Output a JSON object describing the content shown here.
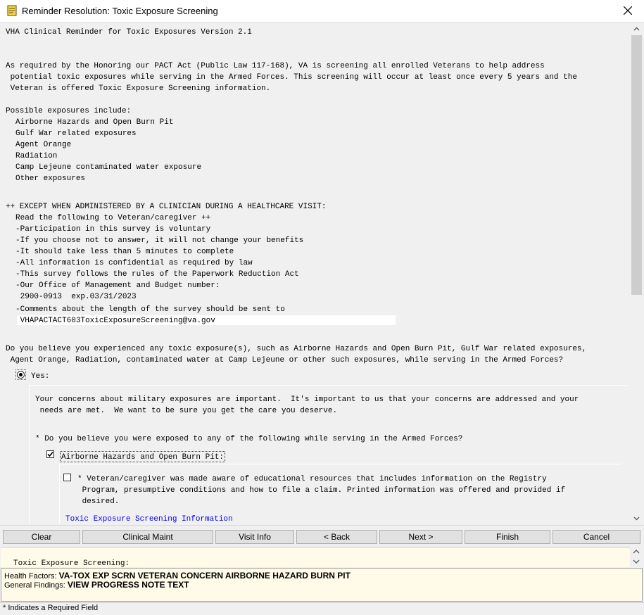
{
  "window": {
    "title": "Reminder Resolution: Toxic Exposure Screening",
    "icon": "reminder-app-icon"
  },
  "content": {
    "header": "VHA Clinical Reminder for Toxic Exposures Version 2.1",
    "intro_lines": [
      "As required by the Honoring our PACT Act (Public Law 117-168), VA is screening all enrolled Veterans to help address",
      " potential toxic exposures while serving in the Armed Forces. This screening will occur at least once every 5 years and the",
      " Veteran is offered Toxic Exposure Screening information."
    ],
    "exposures_heading": "Possible exposures include:",
    "exposures": [
      "Airborne Hazards and Open Burn Pit",
      "Gulf War related exposures",
      "Agent Orange",
      "Radiation",
      "Camp Lejeune contaminated water exposure",
      "Other exposures"
    ],
    "except_heading": "++ EXCEPT WHEN ADMINISTERED BY A CLINICIAN DURING A HEALTHCARE VISIT:",
    "except_lines": [
      "Read the following to Veteran/caregiver ++",
      "-Participation in this survey is voluntary",
      "-If you choose not to answer, it will not change your benefits",
      "-It should take less than 5 minutes to complete",
      "-All information is confidential as required by law",
      "-This survey follows the rules of the Paperwork Reduction Act",
      "-Our Office of Management and Budget number:",
      " 2900-0913  exp.03/31/2023",
      "-Comments about the length of the survey should be sent to",
      " VHAPACTACT603ToxicExposureScreening@va.gov"
    ],
    "question_lines": [
      "Do you believe you experienced any toxic exposure(s), such as Airborne Hazards and Open Burn Pit, Gulf War related exposures,",
      " Agent Orange, Radiation, contaminated water at Camp Lejeune or other such exposures, while serving in the Armed Forces?"
    ],
    "yes_label": "Yes:",
    "yes_selected": true,
    "concern_lines": [
      "Your concerns about military exposures are important.  It's important to us that your concerns are addressed and your",
      " needs are met.  We want to be sure you get the care you deserve."
    ],
    "sub_question": "* Do you believe you were exposed to any of the following while serving in the Armed Forces?",
    "airborne_label": "Airborne Hazards and Open Burn Pit:",
    "airborne_checked": true,
    "education_lines": [
      "* Veteran/caregiver was made aware of educational resources that includes information on the Registry",
      " Program, presumptive conditions and how to file a claim. Printed information was offered and provided if",
      " desired."
    ],
    "education_checked": false,
    "info_link": "Toxic Exposure Screening Information"
  },
  "buttons": {
    "clear": "Clear",
    "clinical_maint": "Clinical Maint",
    "visit_info": "Visit Info",
    "back": "< Back",
    "next": "Next >",
    "finish": "Finish",
    "cancel": "Cancel"
  },
  "preview": {
    "text": "Toxic Exposure Screening:"
  },
  "findings": {
    "health_factors_label": "Health Factors:",
    "health_factors_value": "VA-TOX EXP SCRN VETERAN CONCERN AIRBORNE HAZARD BURN PIT",
    "general_findings_label": "General Findings:",
    "general_findings_value": "VIEW PROGRESS NOTE TEXT"
  },
  "status": {
    "required_note": "* Indicates a Required Field"
  }
}
